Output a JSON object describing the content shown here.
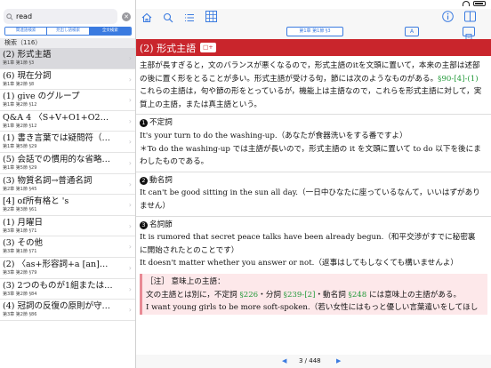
{
  "search": {
    "value": "read",
    "clear_glyph": "✕"
  },
  "segments": [
    {
      "label": "関連語検索",
      "active": false
    },
    {
      "label": "見出し語検索",
      "active": false
    },
    {
      "label": "全文検索",
      "active": true
    }
  ],
  "list_header": "検索（116）",
  "results": [
    {
      "title": "(2) 形式主語",
      "location": "第1章 第1節 §3",
      "selected": true
    },
    {
      "title": "(6) 現在分詞",
      "location": "第1章 第2節 §8",
      "selected": false
    },
    {
      "title": "(1) give のグループ",
      "location": "第1章 第2節 §12",
      "selected": false
    },
    {
      "title": "Q&A 4 〈S+V+O1+O2…",
      "location": "第1章 第2節 §12",
      "selected": false
    },
    {
      "title": "(1) 書き言葉では疑問符（…",
      "location": "第1章 第5節 §29",
      "selected": false
    },
    {
      "title": "(5) 会話での慣用的な省略…",
      "location": "第1章 第5節 §29",
      "selected": false
    },
    {
      "title": "(3) 物質名詞→普通名詞",
      "location": "第2章 第1節 §45",
      "selected": false
    },
    {
      "title": "[4] of所有格と 's",
      "location": "第2章 第3節 §61",
      "selected": false
    },
    {
      "title": "(1) 月曜日",
      "location": "第3章 第1節 §71",
      "selected": false
    },
    {
      "title": "(3) その他",
      "location": "第3章 第1節 §71",
      "selected": false
    },
    {
      "title": "(2) 〈as+形容詞+a [an]…",
      "location": "第3章 第2節 §79",
      "selected": false
    },
    {
      "title": "(3) 2つのものが1組または…",
      "location": "第3章 第2節 §84",
      "selected": false
    },
    {
      "title": "(4) 冠詞の反復の原則が守…",
      "location": "第3章 第2節 §86",
      "selected": false
    }
  ],
  "toolbar": {
    "location_label": "第1章 第1節 §3",
    "aa_label": "A"
  },
  "section": {
    "title": "(2) 形式主語",
    "badge": "□+"
  },
  "content": {
    "intro": "主部が長すぎると，文のバランスが悪くなるので，形式主語のitを文頭に置いて，本来の主部は述部の後に置く形をとることが多い。形式主語が受ける句，節には次のようなものがある。",
    "intro_link": "§90-[4]-(1)",
    "intro2": "これらの主語は，句や節の形をとっているが，機能上は主語なので，これらを形式主語に対して，実質上の主語，または真主語という。",
    "items": [
      {
        "num": "1",
        "heading": "不定詞",
        "lines": [
          "It's your turn to do the washing-up.（あなたが食器洗いをする番ですよ）",
          "＊To do the washing-up では主語が長いので，形式主語の it を文頭に置いて to do 以下を後にまわしたものである。"
        ]
      },
      {
        "num": "2",
        "heading": "動名詞",
        "lines": [
          "It can't be good sitting in the sun all day.（一日中ひなたに座っているなんて，いいはずがありません）"
        ]
      },
      {
        "num": "3",
        "heading": "名詞節",
        "lines": [
          "It is rumored that secret peace talks have been already begun.（和平交渉がすでに秘密裏に開始されたとのことです）",
          "It doesn't matter whether you answer or not.（返事はしてもしなくても構いませんよ）"
        ]
      }
    ],
    "note": {
      "title": "［注］ 意味上の主語：",
      "line1_pre": "文の主語とは別に，不定詞 ",
      "link1": "§226",
      "line1_mid1": "・分詞 ",
      "link2": "§239-[2]",
      "line1_mid2": "・動名詞 ",
      "link3": "§248",
      "line1_post": " には意味上の主語がある。",
      "line2": "I want young girls to be more soft-spoken.（若い女性にはもっと優しい言葉遣いをしてほし"
    }
  },
  "footer": {
    "prev": "◀",
    "page": "3 / 448",
    "next": "▶"
  },
  "icons": [
    "home-icon",
    "search-icon",
    "list-icon",
    "grid-icon",
    "info-icon",
    "sidebar-icon"
  ],
  "colors": {
    "accent": "#3b7be0",
    "title_bar": "#c9252c",
    "link": "#239a3a",
    "note_bg": "#fde8ea"
  }
}
